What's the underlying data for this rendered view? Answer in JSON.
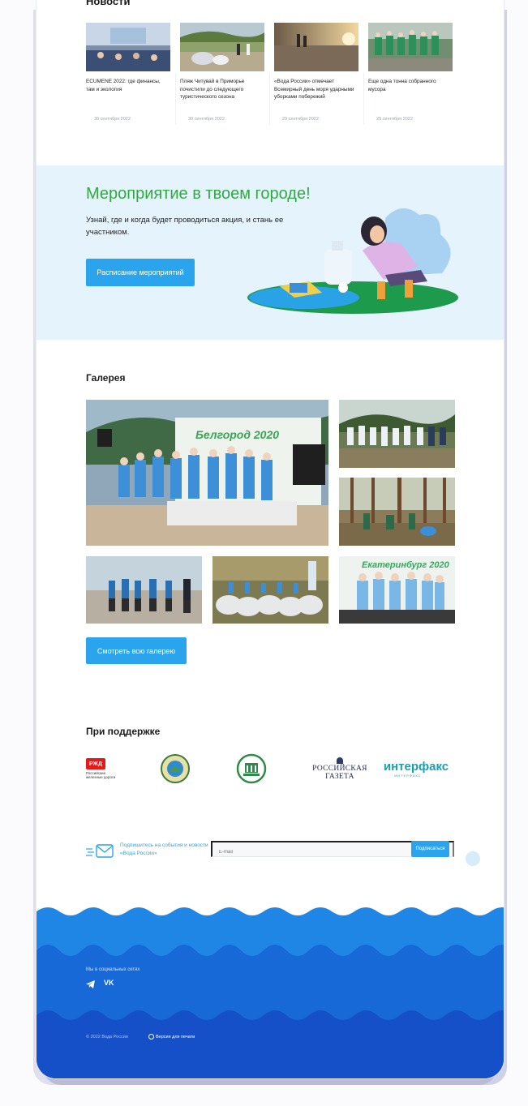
{
  "news": {
    "title": "Новости",
    "items": [
      {
        "text": "ECUMENE 2022: где финансы, там и экология",
        "date": "30 сентября 2022"
      },
      {
        "text": "Пляж Читувай в Приморье почистили до следующего туристического сезона",
        "date": "30 сентября 2022"
      },
      {
        "text": "«Вода России» отмечает Всемирный день моря ударными уборками побережий",
        "date": "29 сентября 2022"
      },
      {
        "text": "Еще одна тонна собранного мусора",
        "date": "29 сентября 2022"
      }
    ]
  },
  "event": {
    "title": "Мероприятие в твоем городе!",
    "subtitle": "Узнай, где и когда будет проводиться акция, и стань ее участником.",
    "button": "Расписание мероприятий"
  },
  "gallery": {
    "title": "Галерея",
    "photo_labels": [
      "Белгород 2020",
      "Екатеринбург 2020"
    ],
    "button": "Смотреть всю галерею"
  },
  "partners": {
    "title": "При поддержке",
    "logos": [
      {
        "name": "rzd-logo",
        "text": "РЖД",
        "caption": "Российские железные дороги"
      },
      {
        "name": "emblem-logo",
        "text": ""
      },
      {
        "name": "ministry-logo",
        "text": ""
      },
      {
        "name": "rg-logo",
        "text": "РОССИЙСКАЯ ГАЗЕТА"
      },
      {
        "name": "interfax-logo",
        "text": "интерфакс",
        "caption": "ИНТЕРФАКС"
      }
    ]
  },
  "subscribe": {
    "text": "Подпишитесь на события и новости «Вода России»",
    "placeholder": "E-mail",
    "button": "Подписаться"
  },
  "footer": {
    "social_label": "Мы в социальных сетях",
    "icons": [
      "telegram-icon",
      "vk-icon"
    ],
    "vk_text": "VK",
    "copyright": "© 2022 Вода России",
    "print_version": "Версия для печати"
  },
  "colors": {
    "accent": "#2ba4ee",
    "event_title": "#2faa3f",
    "event_bg": "#e5f3fd",
    "footer_wave_1": "#1f86e6",
    "footer_wave_2": "#1769d8",
    "footer_bottom": "#1650c8"
  }
}
